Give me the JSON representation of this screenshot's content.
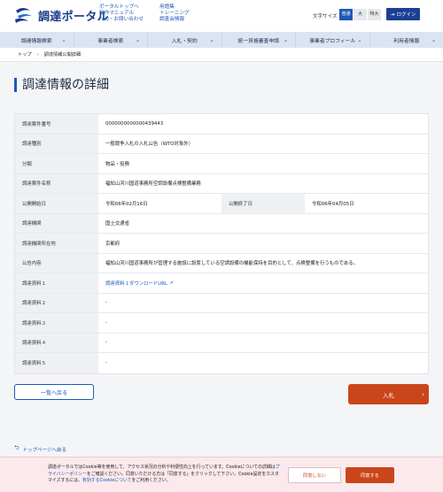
{
  "header": {
    "logo_text": "調達ポータル",
    "links_col1": [
      "ポータルトップへ",
      "操作マニュアル",
      "FAQ・お問い合わせ"
    ],
    "links_col2": [
      "用語集",
      "トレーニング",
      "調査会情報"
    ],
    "font_size_label": "文字サイズ",
    "font_sizes": [
      "普通",
      "大",
      "特大"
    ],
    "login_label": "ログイン",
    "colors": {
      "brand": "#1c3f94",
      "accent": "#c9461a"
    }
  },
  "nav": {
    "items": [
      "調達情報検索",
      "事業者検索",
      "入札・契約",
      "統一資格審査申請",
      "事業者プロフィール",
      "利用者情報"
    ]
  },
  "breadcrumb": {
    "home": "トップ",
    "current": "調達情報公開詳細"
  },
  "page_title": "調達情報の詳細",
  "details": {
    "case_number_label": "調達案件番号",
    "case_number": "0000000000000439443",
    "type_label": "調達種別",
    "type": "一般競争入札の入札公告（WTO対象外）",
    "category_label": "分類",
    "category": "物品・役務",
    "name_label": "調達案件名称",
    "name": "福知山河川国道事務所空調設備点検整備業務",
    "start_label": "公開開始日",
    "start": "令和06年02月16日",
    "end_label": "公開終了日",
    "end": "令和06年04月05日",
    "agency_label": "調達機関",
    "agency": "国土交通省",
    "location_label": "調達機関所在地",
    "location": "京都府",
    "notice_label": "公告内容",
    "notice": "福知山河川国道事務所が管理する施設に設置している空調設備の機能保持を目的として、点検整備を行うものである。",
    "doc1_label": "調達資料１",
    "doc1": "調達資料１ダウンロードURL",
    "doc2_label": "調達資料２",
    "doc2": "-",
    "doc3_label": "調達資料３",
    "doc3": "-",
    "doc4_label": "調達資料４",
    "doc4": "-",
    "doc5_label": "調達資料５",
    "doc5": "-"
  },
  "buttons": {
    "back": "一覧へ戻る",
    "bid": "入札"
  },
  "top_link": "トップページへ戻る",
  "cookie": {
    "text_1": "調達ポータルではCookie等を使用して、アクセス状況の分析や利便性向上を行っています。Cookieについての詳細は",
    "policy_link": "プライバシーポリシー",
    "text_2": "をご確認ください。同意いただける方は「同意する」をクリックして下さい。Cookie設定をカスタマイズするには、",
    "settings_link": "有効するCookieについて",
    "text_3": "をご利用ください。",
    "decline": "同意しない",
    "accept": "同意する"
  }
}
